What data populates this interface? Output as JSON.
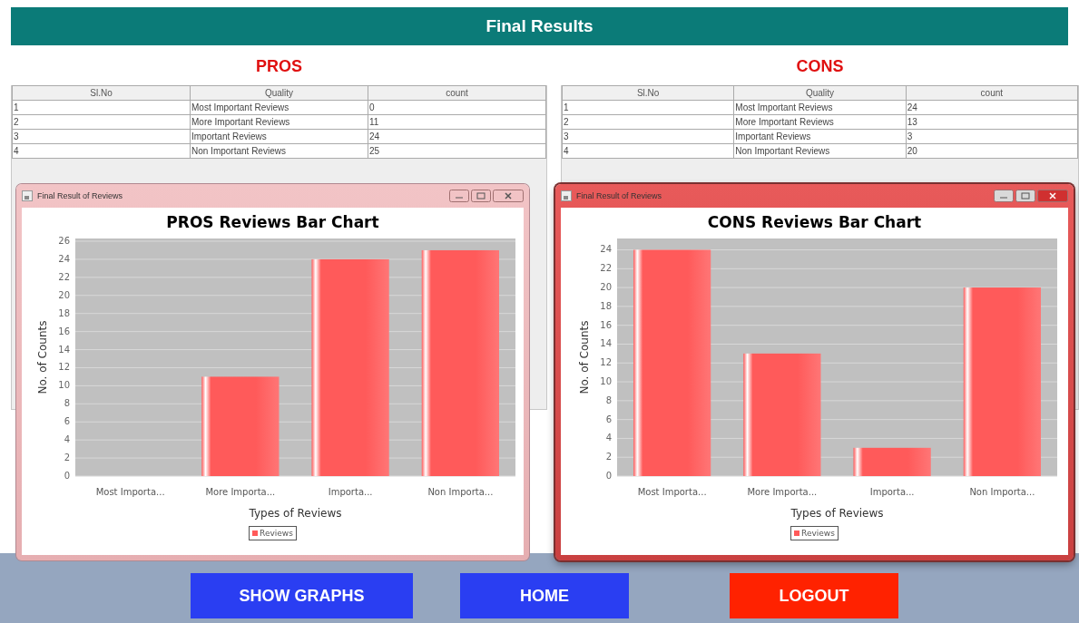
{
  "header": {
    "title": "Final Results"
  },
  "panels": [
    {
      "heading": "PROS",
      "table": {
        "columns": [
          "Sl.No",
          "Quality",
          "count"
        ],
        "rows": [
          [
            "1",
            "Most Important Reviews",
            "0"
          ],
          [
            "2",
            "More Important Reviews",
            "11"
          ],
          [
            "3",
            "Important Reviews",
            "24"
          ],
          [
            "4",
            "Non Important Reviews",
            "25"
          ]
        ]
      },
      "window": {
        "title": "Final Result of Reviews",
        "active": false,
        "chart_data": {
          "type": "bar",
          "title": "PROS Reviews Bar Chart",
          "xlabel": "Types of Reviews",
          "ylabel": "No. of Counts",
          "categories": [
            "Most Importa...",
            "More Importa...",
            "Importa...",
            "Non Importa..."
          ],
          "series": [
            {
              "name": "Reviews",
              "color": "#ff5a5a",
              "values": [
                0,
                11,
                24,
                25
              ]
            }
          ],
          "grid": true,
          "ylim": [
            0,
            26.3
          ],
          "yticks": [
            0,
            2,
            4,
            6,
            8,
            10,
            12,
            14,
            16,
            18,
            20,
            22,
            24,
            26
          ]
        }
      }
    },
    {
      "heading": "CONS",
      "table": {
        "columns": [
          "Sl.No",
          "Quality",
          "count"
        ],
        "rows": [
          [
            "1",
            "Most Important Reviews",
            "24"
          ],
          [
            "2",
            "More Important Reviews",
            "13"
          ],
          [
            "3",
            "Important Reviews",
            "3"
          ],
          [
            "4",
            "Non Important Reviews",
            "20"
          ]
        ]
      },
      "window": {
        "title": "Final Result of Reviews",
        "active": true,
        "chart_data": {
          "type": "bar",
          "title": "CONS Reviews Bar Chart",
          "xlabel": "Types of Reviews",
          "ylabel": "No. of Counts",
          "categories": [
            "Most Importa...",
            "More Importa...",
            "Importa...",
            "Non Importa..."
          ],
          "series": [
            {
              "name": "Reviews",
              "color": "#ff5a5a",
              "values": [
                24,
                13,
                3,
                20
              ]
            }
          ],
          "grid": true,
          "ylim": [
            0,
            25.2
          ],
          "yticks": [
            0,
            2,
            4,
            6,
            8,
            10,
            12,
            14,
            16,
            18,
            20,
            22,
            24
          ]
        }
      }
    }
  ],
  "buttons": [
    {
      "label": "SHOW GRAPHS",
      "kind": "primary"
    },
    {
      "label": "HOME",
      "kind": "primary"
    },
    {
      "label": "LOGOUT",
      "kind": "danger"
    }
  ]
}
